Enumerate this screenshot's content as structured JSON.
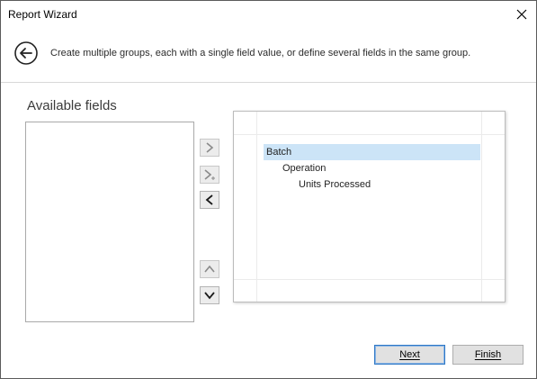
{
  "window": {
    "title": "Report Wizard"
  },
  "header": {
    "instruction": "Create multiple groups, each with a single field value, or define several fields in the same group."
  },
  "available": {
    "label": "Available fields",
    "items": []
  },
  "groups": {
    "items": [
      {
        "label": "Batch",
        "selected": true
      },
      {
        "label": "Operation",
        "selected": false
      },
      {
        "label": "Units Processed",
        "selected": false
      }
    ]
  },
  "buttons": {
    "next": "Next",
    "finish": "Finish"
  },
  "colors": {
    "selection": "#cce4f7",
    "accent": "#2f78c5"
  },
  "icons": {
    "close": "close-icon",
    "back": "back-arrow-icon",
    "add": "chevron-right-icon",
    "add_to_group": "chevron-right-plus-icon",
    "remove": "chevron-left-icon",
    "up": "chevron-up-icon",
    "down": "chevron-down-icon"
  }
}
